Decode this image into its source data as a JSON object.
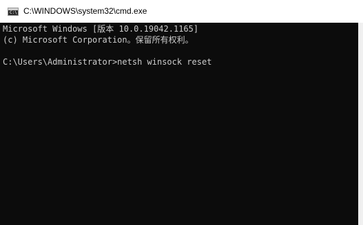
{
  "window": {
    "title": "C:\\WINDOWS\\system32\\cmd.exe",
    "icon": "cmd-icon",
    "icon_glyph": "C:\\"
  },
  "console": {
    "lines": [
      "Microsoft Windows [版本 10.0.19042.1165]",
      "(c) Microsoft Corporation。保留所有权利。",
      "",
      "C:\\Users\\Administrator>netsh winsock reset"
    ]
  },
  "colors": {
    "console_background": "#0c0c0c",
    "console_text": "#cccccc",
    "titlebar_background": "#ffffff"
  }
}
